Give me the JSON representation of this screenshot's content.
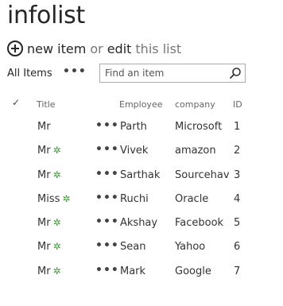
{
  "page": {
    "title": "infolist"
  },
  "actions": {
    "new_item_label": "new item",
    "or_text": "or",
    "edit_label": "edit",
    "this_list_text": "this list",
    "add_icon": "plus-circle-icon"
  },
  "view": {
    "current_view": "All Items",
    "more_label": "•••",
    "search_placeholder": "Find an item",
    "search_icon": "magnifier-icon"
  },
  "table": {
    "select_all_glyph": "✓",
    "columns": [
      "Title",
      "Employee",
      "company",
      "ID"
    ],
    "new_indicator": "✲",
    "row_menu": "•••",
    "rows": [
      {
        "title": "Mr",
        "is_new": false,
        "employee": "Parth",
        "company": "Microsoft",
        "id": "1"
      },
      {
        "title": "Mr",
        "is_new": true,
        "employee": "Vivek",
        "company": "amazon",
        "id": "2"
      },
      {
        "title": "Mr",
        "is_new": true,
        "employee": "Sarthak",
        "company": "Sourcehav",
        "id": "3"
      },
      {
        "title": "Miss",
        "is_new": true,
        "employee": "Ruchi",
        "company": "Oracle",
        "id": "4"
      },
      {
        "title": "Mr",
        "is_new": true,
        "employee": "Akshay",
        "company": "Facebook",
        "id": "5"
      },
      {
        "title": "Mr",
        "is_new": true,
        "employee": "Sean",
        "company": "Yahoo",
        "id": "6"
      },
      {
        "title": "Mr",
        "is_new": true,
        "employee": "Mark",
        "company": "Google",
        "id": "7"
      }
    ]
  },
  "colors": {
    "title_text": "#262626",
    "new_indicator": "#3b9b3b",
    "header_text": "#666666"
  }
}
